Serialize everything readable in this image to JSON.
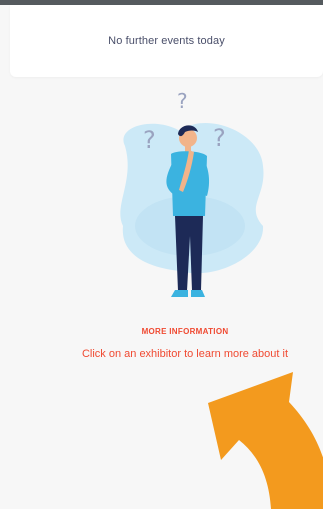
{
  "events": {
    "empty_message": "No further events today"
  },
  "info": {
    "title": "MORE INFORMATION",
    "description": "Click on an exhibitor to learn more about it"
  },
  "colors": {
    "accent": "#f04a32",
    "arrow": "#f39a1e",
    "person_shirt": "#3bb3e0",
    "person_pants": "#1d2a57",
    "blob": "#cce9f7"
  }
}
